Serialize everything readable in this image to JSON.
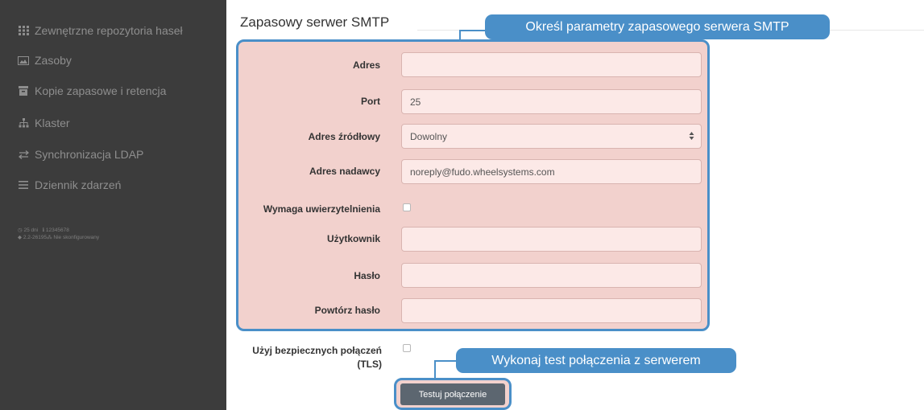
{
  "sidebar": {
    "items": [
      {
        "label": "Zewnętrzne repozytoria haseł",
        "icon": "grid-icon"
      },
      {
        "label": "Zasoby",
        "icon": "image-icon"
      },
      {
        "label": "Kopie zapasowe i retencja",
        "icon": "archive-icon"
      },
      {
        "label": "Klaster",
        "icon": "sitemap-icon"
      },
      {
        "label": "Synchronizacja LDAP",
        "icon": "exchange-icon"
      },
      {
        "label": "Dziennik zdarzeń",
        "icon": "list-icon"
      }
    ],
    "status": {
      "line1_uptime": "25 dni",
      "line1_id": "12345678",
      "line2_version": "2.2-26195",
      "line2_cluster": "Nie skonfigurowany"
    }
  },
  "main": {
    "section_title": "Zapasowy serwer SMTP",
    "fields": {
      "address": {
        "label": "Adres",
        "value": ""
      },
      "port": {
        "label": "Port",
        "value": "25"
      },
      "source_address": {
        "label": "Adres źródłowy",
        "value": "Dowolny"
      },
      "sender_address": {
        "label": "Adres nadawcy",
        "value": "noreply@fudo.wheelsystems.com"
      },
      "auth_required": {
        "label": "Wymaga uwierzytelnienia",
        "checked": false
      },
      "user": {
        "label": "Użytkownik",
        "value": ""
      },
      "password": {
        "label": "Hasło",
        "value": ""
      },
      "password_repeat": {
        "label": "Powtórz hasło",
        "value": ""
      },
      "tls": {
        "label": "Użyj bezpiecznych połączeń (TLS)",
        "checked": false
      }
    },
    "test_button": "Testuj połączenie"
  },
  "callouts": {
    "top": "Określ parametry zapasowego serwera SMTP",
    "bottom": "Wykonaj test połączenia z serwerem"
  },
  "colors": {
    "sidebar_bg": "#3c3c3c",
    "highlight_bg": "#f2d1cd",
    "callout_blue": "#4a8fc8",
    "button_bg": "#5c6670"
  }
}
